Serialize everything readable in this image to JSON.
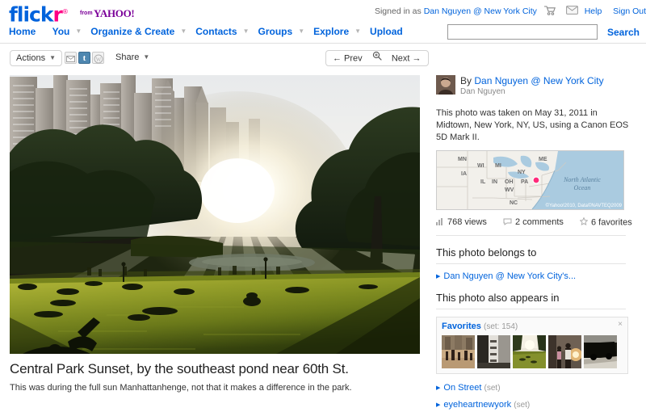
{
  "header": {
    "logo": {
      "part1": "flick",
      "part2": "r",
      "reg": "®",
      "from": "from",
      "yahoo": "YAHOO!"
    },
    "signed_in_prefix": "Signed in as",
    "signed_in_user": "Dan Nguyen @ New York City",
    "cart_icon": "cart-icon",
    "mail_icon": "mail-icon",
    "help": "Help",
    "sign_out": "Sign Out"
  },
  "nav": {
    "items": [
      {
        "label": "Home",
        "caret": false
      },
      {
        "label": "You",
        "caret": true
      },
      {
        "label": "Organize & Create",
        "caret": true
      },
      {
        "label": "Contacts",
        "caret": true
      },
      {
        "label": "Groups",
        "caret": true
      },
      {
        "label": "Explore",
        "caret": true
      },
      {
        "label": "Upload",
        "caret": false
      }
    ],
    "search_value": "",
    "search_placeholder": "",
    "search_button": "Search"
  },
  "toolbar": {
    "actions_label": "Actions",
    "share_label": "Share",
    "caret": "▼",
    "share_icons": [
      {
        "name": "email-icon",
        "glyph": "✉"
      },
      {
        "name": "tumblr-icon",
        "glyph": "t"
      },
      {
        "name": "wordpress-icon",
        "glyph": "Ⓦ"
      }
    ],
    "prev_label": "← Prev",
    "next_label": "Next →",
    "zoom_icon": "magnifier-icon"
  },
  "photo": {
    "title": "Central Park Sunset, by the southeast pond near 60th St.",
    "caption": "This was during the full sun Manhattanhenge, not that it makes a difference in the park.",
    "alt": "Central Park lawn at sunset with sunburst between buildings"
  },
  "sidebar": {
    "by_prefix": "By",
    "author_link": "Dan Nguyen @ New York City",
    "author_realname": "Dan Nguyen",
    "taken_text": "This photo was taken on May 31, 2011 in Midtown, New York, NY, US, using a Canon EOS 5D Mark II.",
    "map": {
      "credit": "©Yahoo!2010, Data©NAVTEQ2009",
      "ocean_label": "North Atlantic Ocean",
      "state_labels": [
        "MN",
        "WI",
        "MI",
        "ME",
        "IA",
        "NY",
        "IL",
        "IN",
        "OH",
        "PA",
        "WV",
        "NC"
      ]
    },
    "stats": [
      {
        "icon": "bar-chart-icon",
        "label": "768 views"
      },
      {
        "icon": "comment-icon",
        "label": "2 comments"
      },
      {
        "icon": "star-icon",
        "label": "6 favorites"
      }
    ],
    "belongs_to_heading": "This photo belongs to",
    "belongs_to_links": [
      "Dan Nguyen @ New York City's..."
    ],
    "appears_in_heading": "This photo also appears in",
    "featured_set": {
      "name": "Favorites",
      "count": "(set: 154)",
      "close": "×",
      "thumbnails": [
        {
          "name": "thumb-street-crowd",
          "current": false
        },
        {
          "name": "thumb-building-facade",
          "current": false
        },
        {
          "name": "thumb-park-lawn",
          "current": true
        },
        {
          "name": "thumb-people-dusk",
          "current": false
        },
        {
          "name": "thumb-dark-vehicle",
          "current": false
        }
      ]
    },
    "other_sets": [
      {
        "name": "On Street",
        "meta": "(set)"
      },
      {
        "name": "eyeheartnewyork",
        "meta": "(set)"
      }
    ]
  }
}
